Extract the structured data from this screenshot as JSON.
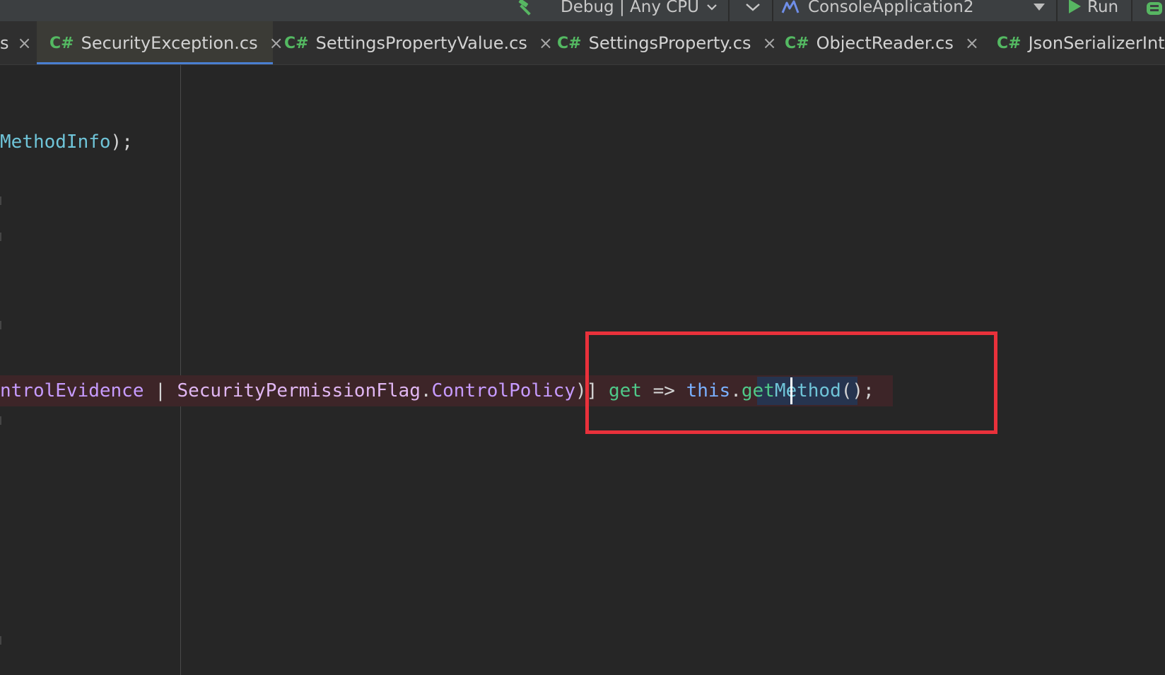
{
  "toolbar": {
    "build_icon": "hammer-icon",
    "configuration": "Debug | Any CPU",
    "app_name": "ConsoleApplication2",
    "run_label": "Run",
    "colors": {
      "background": "#3c3f41",
      "run_green": "#57b662",
      "app_logo": "#6f8ee8"
    }
  },
  "tabs": [
    {
      "lang": "",
      "name": "s",
      "active": false
    },
    {
      "lang": "C#",
      "name": "SecurityException.cs",
      "active": true
    },
    {
      "lang": "C#",
      "name": "SettingsPropertyValue.cs",
      "active": false
    },
    {
      "lang": "C#",
      "name": "SettingsProperty.cs",
      "active": false
    },
    {
      "lang": "C#",
      "name": "ObjectReader.cs",
      "active": false
    },
    {
      "lang": "C#",
      "name": "JsonSerializerInterr",
      "active": false
    }
  ],
  "tab_close_glyph": "×",
  "editor": {
    "line1": {
      "ident": "MethodInfo",
      "tail": ");"
    },
    "line2": {
      "flag1": "ntrolEvidence",
      "pipe": " | ",
      "enum_type": "SecurityPermissionFlag",
      "dot": ".",
      "flag2": "ControlPolicy",
      "close": ")] ",
      "accessor": "get",
      "arrow": " => ",
      "this_kw": "this",
      "dot2": ".",
      "call_a": "get",
      "call_b": "Method",
      "call_tail": "();"
    },
    "colors": {
      "background": "#262626",
      "highlight_line": "#3d2528",
      "selection": "#26344f",
      "annotation_box": "#e9313b"
    }
  }
}
